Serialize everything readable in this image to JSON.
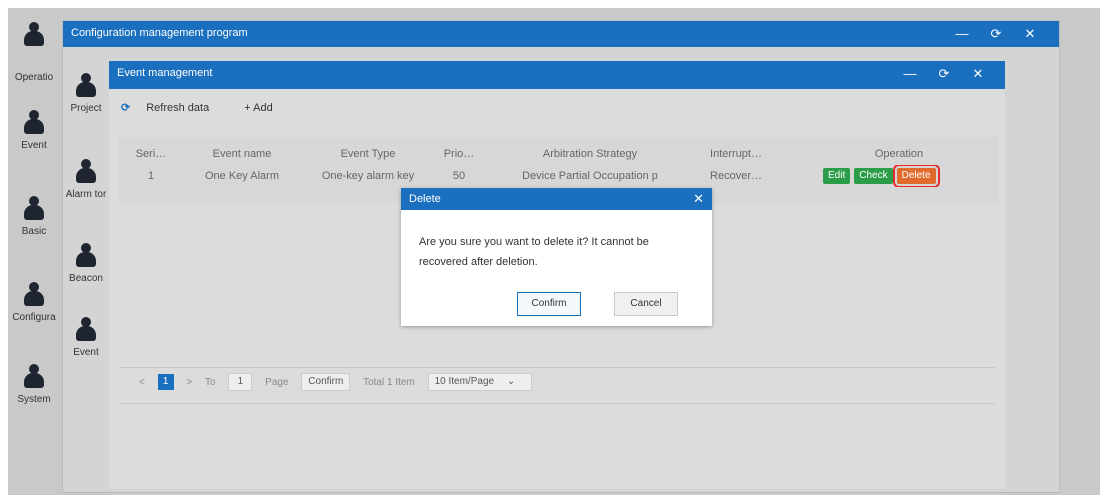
{
  "dock": {
    "items": [
      {
        "label": ""
      },
      {
        "label": "Operatio"
      },
      {
        "label": "Event"
      },
      {
        "label": "Basic"
      },
      {
        "label": "Configura"
      },
      {
        "label": "System"
      }
    ]
  },
  "outer_window": {
    "title": "Configuration management program",
    "sidebar": [
      {
        "label": "Project"
      },
      {
        "label": "Alarm tor"
      },
      {
        "label": "Beacon"
      },
      {
        "label": "Event"
      }
    ]
  },
  "inner_window": {
    "title": "Event management",
    "toolbar": {
      "refresh_label": "Refresh data",
      "add_label": "+ Add"
    },
    "table": {
      "headers": [
        "Seri…",
        "Event name",
        "Event Type",
        "Prio…",
        "Arbitration Strategy",
        "Interrupt…",
        "Operation"
      ],
      "rows": [
        {
          "serial": "1",
          "event_name": "One Key Alarm",
          "event_type": "One-key alarm key",
          "priority": "50",
          "arbitration": "Device Partial Occupation p",
          "interrupt": "Recover…"
        }
      ],
      "row_buttons": {
        "edit": "Edit",
        "check": "Check",
        "delete": "Delete"
      }
    },
    "pager": {
      "current_page": "1",
      "to_label": "To",
      "page_input": "1",
      "page_label": "Page",
      "confirm_label": "Confirm",
      "total_label": "Total 1 Item",
      "page_size": "10 Item/Page"
    }
  },
  "dialog": {
    "title": "Delete",
    "message": "Are you sure you want to delete it? It cannot be recovered after deletion.",
    "confirm_label": "Confirm",
    "cancel_label": "Cancel"
  },
  "colors": {
    "accent": "#1a6fbe",
    "success": "#2b9c48",
    "danger": "#e06b2c",
    "highlight": "#e82a2a"
  }
}
